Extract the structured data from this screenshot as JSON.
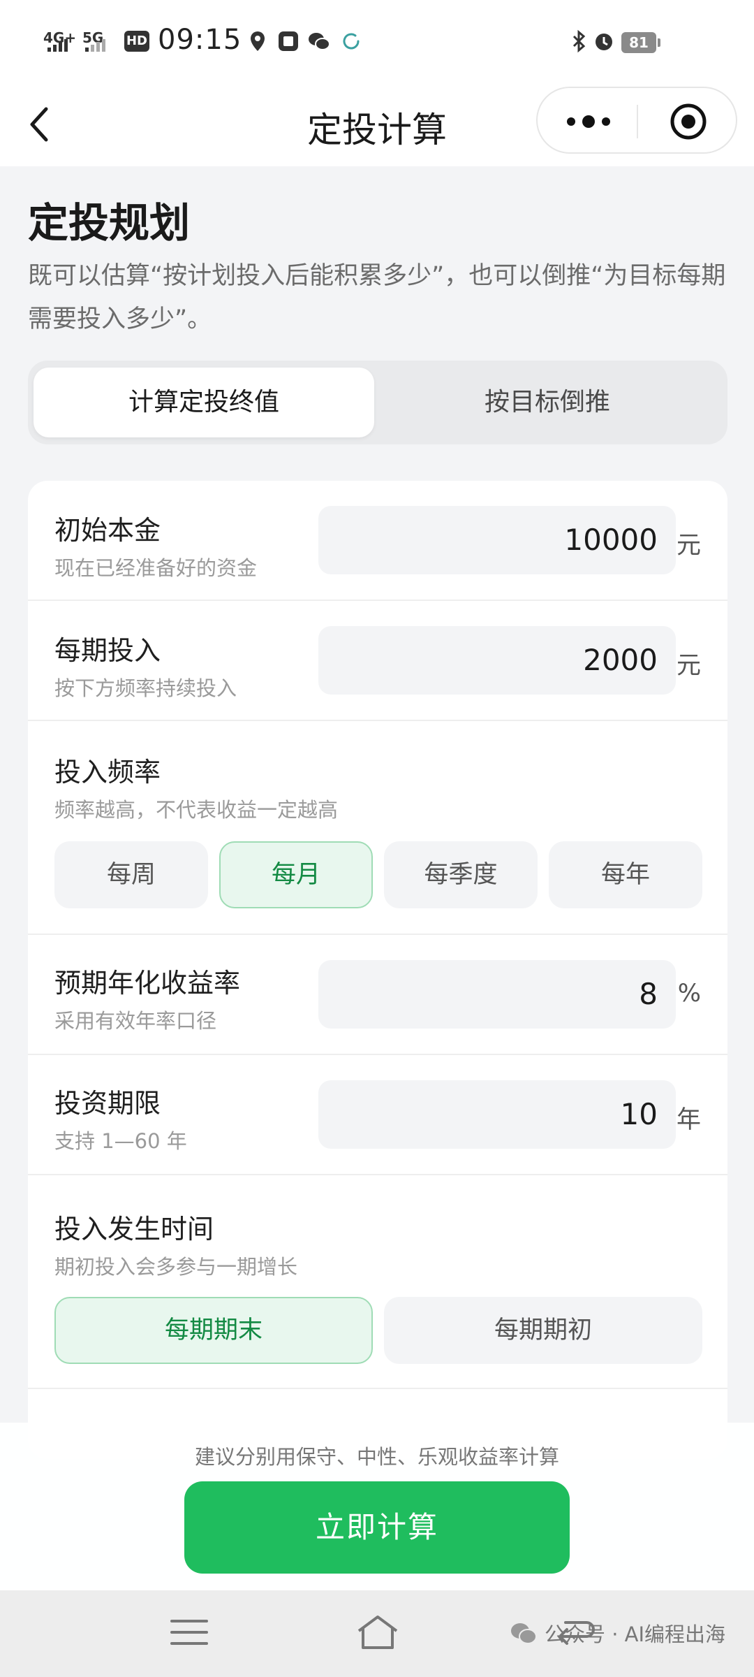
{
  "status_bar": {
    "network1": "4G+",
    "network2": "5G",
    "hd": "HD",
    "time": "09:15",
    "battery": "81",
    "icons": [
      "location-icon",
      "taobao-icon",
      "wechat-icon",
      "loading-icon",
      "bluetooth-icon",
      "alarm-icon"
    ]
  },
  "nav": {
    "title": "定投计算",
    "back_icon": "chevron-left-icon",
    "more_icon": "more-dots-icon",
    "close_icon": "target-close-icon"
  },
  "header": {
    "title": "定投规划",
    "description": "既可以估算“按计划投入后能积累多少”，也可以倒推“为目标每期需要投入多少”。"
  },
  "tabs": [
    {
      "label": "计算定投终值",
      "active": true
    },
    {
      "label": "按目标倒推",
      "active": false
    }
  ],
  "form": {
    "principal": {
      "label": "初始本金",
      "sub": "现在已经准备好的资金",
      "value": "10000",
      "unit": "元"
    },
    "periodic": {
      "label": "每期投入",
      "sub": "按下方频率持续投入",
      "value": "2000",
      "unit": "元"
    },
    "frequency": {
      "label": "投入频率",
      "sub": "频率越高，不代表收益一定越高",
      "options": [
        "每周",
        "每月",
        "每季度",
        "每年"
      ],
      "selected": "每月"
    },
    "rate": {
      "label": "预期年化收益率",
      "sub": "采用有效年率口径",
      "value": "8",
      "unit": "%"
    },
    "term": {
      "label": "投资期限",
      "sub": "支持 1—60 年",
      "value": "10",
      "unit": "年"
    },
    "timing": {
      "label": "投入发生时间",
      "sub": "期初投入会多参与一期增长",
      "options": [
        "每期期末",
        "每期期初"
      ],
      "selected": "每期期末"
    }
  },
  "bottom": {
    "hint": "建议分别用保守、中性、乐观收益率计算",
    "cta": "立即计算"
  },
  "watermark": "公众号 · AI编程出海",
  "colors": {
    "accent": "#1fbd5e",
    "selected_bg": "#e8f7ee",
    "selected_text": "#138a43"
  }
}
